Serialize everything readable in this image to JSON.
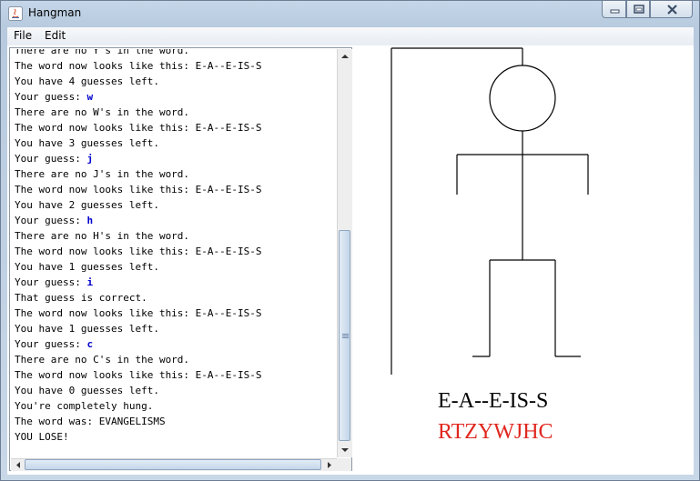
{
  "window": {
    "title": "Hangman"
  },
  "menu": [
    "File",
    "Edit"
  ],
  "log": [
    {
      "text": "There are no Y's in the word."
    },
    {
      "text": "The word now looks like this: E-A--E-IS-S"
    },
    {
      "text": "You have 4 guesses left."
    },
    {
      "text": "Your guess: ",
      "guess": "w"
    },
    {
      "text": "There are no W's in the word."
    },
    {
      "text": "The word now looks like this: E-A--E-IS-S"
    },
    {
      "text": "You have 3 guesses left."
    },
    {
      "text": "Your guess: ",
      "guess": "j"
    },
    {
      "text": "There are no J's in the word."
    },
    {
      "text": "The word now looks like this: E-A--E-IS-S"
    },
    {
      "text": "You have 2 guesses left."
    },
    {
      "text": "Your guess: ",
      "guess": "h"
    },
    {
      "text": "There are no H's in the word."
    },
    {
      "text": "The word now looks like this: E-A--E-IS-S"
    },
    {
      "text": "You have 1 guesses left."
    },
    {
      "text": "Your guess: ",
      "guess": "i"
    },
    {
      "text": "That guess is correct."
    },
    {
      "text": "The word now looks like this: E-A--E-IS-S"
    },
    {
      "text": "You have 1 guesses left."
    },
    {
      "text": "Your guess: ",
      "guess": "c"
    },
    {
      "text": "There are no C's in the word."
    },
    {
      "text": "The word now looks like this: E-A--E-IS-S"
    },
    {
      "text": "You have 0 guesses left."
    },
    {
      "text": "You're completely hung."
    },
    {
      "text": "The word was: EVANGELISMS"
    },
    {
      "text": "YOU LOSE!"
    }
  ],
  "board": {
    "word_display": "E-A--E-IS-S",
    "wrong_letters": "RTZYWJHC",
    "wrong_color": "#e0271f",
    "guess_color": "#0000cc"
  }
}
